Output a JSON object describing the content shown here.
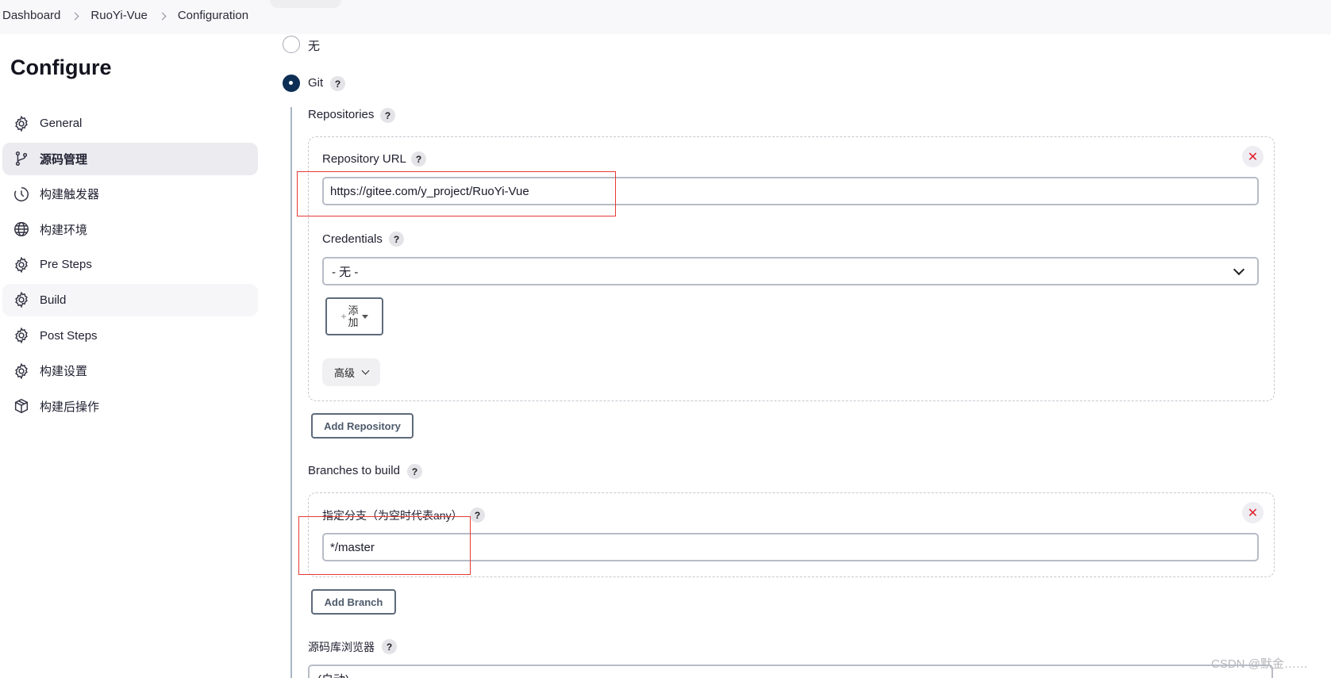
{
  "breadcrumb": {
    "items": [
      "Dashboard",
      "RuoYi-Vue",
      "Configuration"
    ]
  },
  "page": {
    "title": "Configure"
  },
  "sidebar": {
    "items": [
      {
        "label": "General",
        "icon": "gear-icon"
      },
      {
        "label": "源码管理",
        "icon": "branch-icon",
        "active": true
      },
      {
        "label": "构建触发器",
        "icon": "clock-icon"
      },
      {
        "label": "构建环境",
        "icon": "globe-icon"
      },
      {
        "label": "Pre Steps",
        "icon": "gear-icon"
      },
      {
        "label": "Build",
        "icon": "gear-icon"
      },
      {
        "label": "Post Steps",
        "icon": "gear-icon"
      },
      {
        "label": "构建设置",
        "icon": "gear-icon"
      },
      {
        "label": "构建后操作",
        "icon": "package-icon"
      }
    ]
  },
  "scm": {
    "none_label": "无",
    "git_label": "Git",
    "help": "?",
    "repositories_label": "Repositories",
    "repo_url_label": "Repository URL",
    "repo_url_value": "https://gitee.com/y_project/RuoYi-Vue",
    "credentials_label": "Credentials",
    "credentials_value": "- 无 -",
    "add_label_top": "添",
    "add_label_bottom": "加",
    "add_plus": "+",
    "advanced_label": "高级",
    "add_repository_label": "Add Repository",
    "branches_label": "Branches to build",
    "branch_spec_label": "指定分支（为空时代表any）",
    "branch_spec_value": "*/master",
    "add_branch_label": "Add Branch",
    "repo_browser_label": "源码库浏览器",
    "repo_browser_value": "(自动)",
    "close_glyph": "✕"
  },
  "colors": {
    "accent": "#0e2f55",
    "close_red": "#e0212e",
    "highlight_red": "#e53935"
  },
  "watermark": "CSDN @默金……"
}
